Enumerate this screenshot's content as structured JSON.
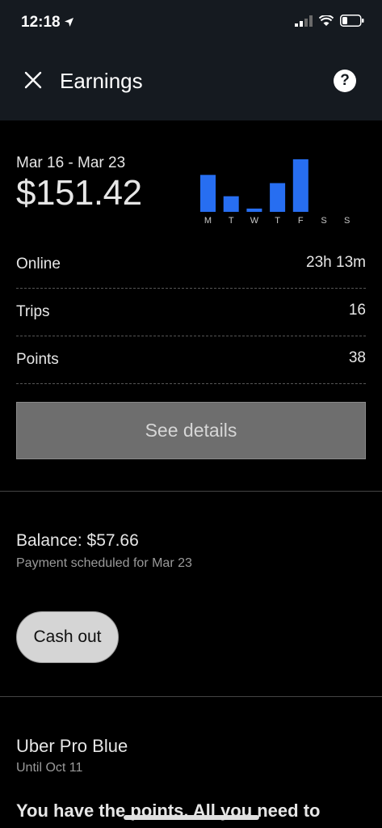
{
  "status_bar": {
    "time": "12:18"
  },
  "header": {
    "title": "Earnings"
  },
  "summary": {
    "date_range": "Mar 16 - Mar 23",
    "total": "$151.42"
  },
  "chart_data": {
    "type": "bar",
    "categories": [
      "M",
      "T",
      "W",
      "T",
      "F",
      "S",
      "S"
    ],
    "values": [
      45,
      19,
      4,
      35,
      64,
      0,
      0
    ],
    "title": "",
    "xlabel": "",
    "ylabel": "",
    "color": "#276ef1",
    "grid": false
  },
  "stats": [
    {
      "label": "Online",
      "value": "23h 13m"
    },
    {
      "label": "Trips",
      "value": "16"
    },
    {
      "label": "Points",
      "value": "38"
    }
  ],
  "see_details_label": "See details",
  "balance": {
    "text": "Balance: $57.66",
    "note": "Payment scheduled for Mar 23",
    "cashout_label": "Cash out"
  },
  "pro": {
    "tier": "Uber Pro Blue",
    "until": "Until Oct 11",
    "message": "You have the points. All you need to"
  }
}
